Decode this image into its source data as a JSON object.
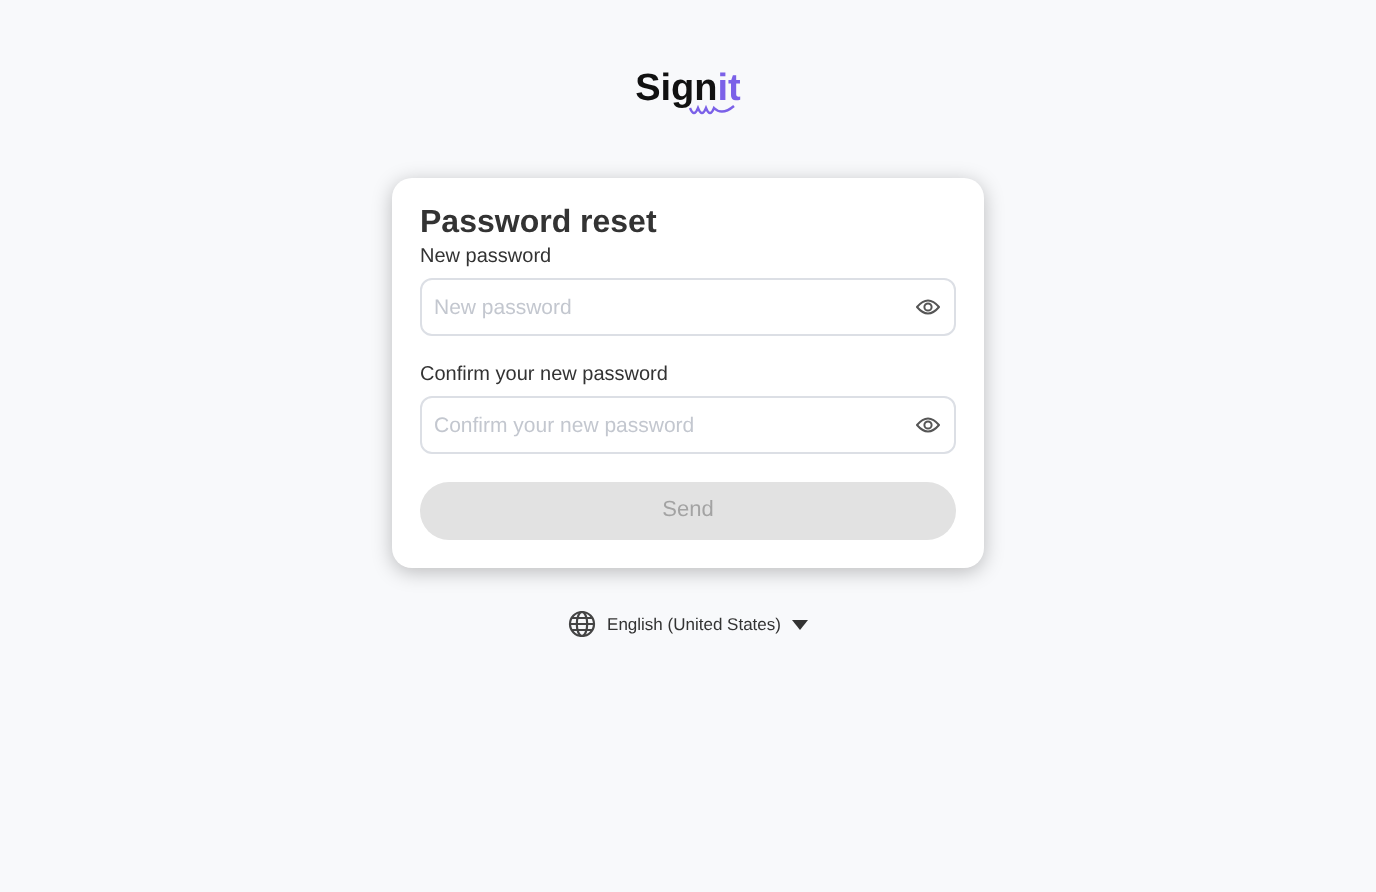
{
  "logo": {
    "parts": [
      {
        "text": "Sign",
        "accent": false
      },
      {
        "text": "it",
        "accent": true
      }
    ]
  },
  "card": {
    "title": "Password reset",
    "fields": [
      {
        "label": "New password",
        "placeholder": "New password"
      },
      {
        "label": "Confirm your new password",
        "placeholder": "Confirm your new password"
      }
    ],
    "button": {
      "label": "Send",
      "disabled": true
    }
  },
  "language": {
    "label": "English (United States)"
  }
}
